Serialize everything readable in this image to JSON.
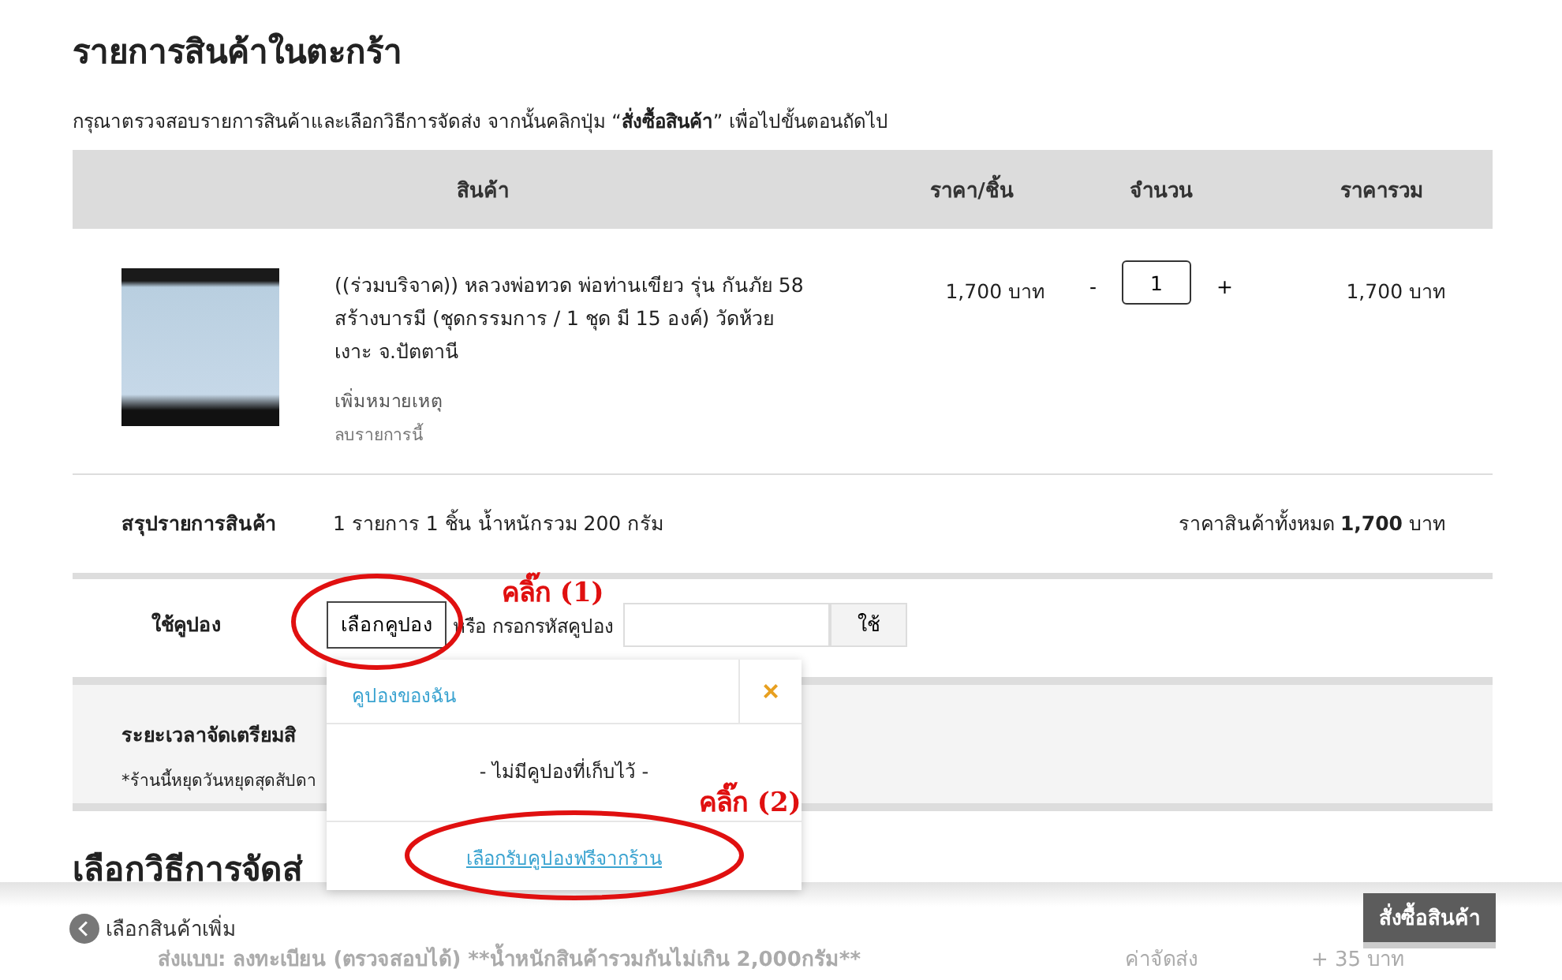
{
  "title": "รายการสินค้าในตะกร้า",
  "instruction": "กรุณาตรวจสอบรายการสินค้าและเลือกวิธีการจัดส่ง จากนั้นคลิกปุ่ม “**สั่งซื้อสินค้า**” เพื่อไปขั้นตอนถัดไป",
  "table": {
    "columns": [
      "สินค้า",
      "ราคา/ชิ้น",
      "จำนวน",
      "ราคารวม"
    ],
    "rows": [
      {
        "name": "((ร่วมบริจาค)) หลวงพ่อทวด พ่อท่านเขียว รุ่น กันภัย 58 สร้างบารมี (ชุดกรรมการ / 1 ชุด มี 15 องค์) วัดห้วยเงาะ จ.ปัตตานี",
        "add_note": "เพิ่มหมายเหตุ",
        "remove": "ลบรายการนี้",
        "unit_price": "1,700 บาท",
        "decrease": "-",
        "quantity": "1",
        "increase": "+",
        "total": "1,700 บาท"
      }
    ]
  },
  "summary": {
    "label": "สรุปรายการสินค้า",
    "detail": "1 รายการ 1 ชิ้น น้ำหนักรวม 200 กรัม",
    "total_label": "ราคาสินค้าทั้งหมด",
    "total": "**1,700** บาท"
  },
  "coupon": {
    "label": "ใช้คูปอง",
    "choose_button": "เลือกคูปอง",
    "or_text": "หรือ กรอกรหัสคูปอง",
    "apply_button": "ใช้"
  },
  "coupon_popup": {
    "title": "คูปองของฉัน",
    "close": "×",
    "empty": "- ไม่มีคูปองที่เก็บไว้ -",
    "link": "เลือกรับคูปองฟรีจากร้าน"
  },
  "preparation": {
    "title": "ระยะเวลาจัดเตรียมสิ",
    "note": "*ร้านนี้หยุดวันหยุดสุดสัปดา"
  },
  "shipping": {
    "heading": "เลือกวิธีการจัดส่",
    "options": [
      {
        "label": "ส่งแบบ: ลงทะเบียน (ตรวจสอบได้) **น้ำหนักสินค้ารวมกันไม่เกิน 2,000กรัม**",
        "fee_label": "ค่าจัดส่ง",
        "fee": "+ 35 บาท"
      }
    ]
  },
  "footer": {
    "back": "เลือกสินค้าเพิ่ม",
    "order_button": "สั่งซื้อสินค้า"
  },
  "annotations": [
    {
      "text": "คลิ๊ก (1)"
    },
    {
      "text": "คลิ๊ก (2)"
    }
  ]
}
